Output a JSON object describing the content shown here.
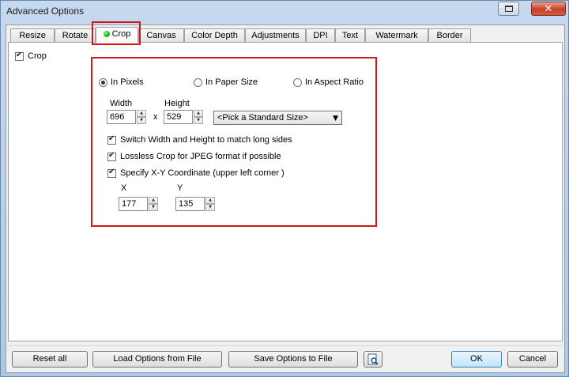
{
  "window": {
    "title": "Advanced Options"
  },
  "tabs": [
    "Resize",
    "Rotate",
    "Crop",
    "Canvas",
    "Color Depth",
    "Adjustments",
    "DPI",
    "Text",
    "Watermark",
    "Border"
  ],
  "active_tab": "Crop",
  "crop": {
    "enable_label": "Crop",
    "enable_checked": true,
    "mode_options": [
      "In Pixels",
      "In Paper Size",
      "In Aspect Ratio"
    ],
    "selected_mode": "In Pixels",
    "width_label": "Width",
    "height_label": "Height",
    "width_value": "696",
    "height_value": "529",
    "times_label": "x",
    "standard_size": "<Pick a Standard Size>",
    "options": [
      {
        "label": "Switch Width and Height to match long sides",
        "checked": true
      },
      {
        "label": "Lossless Crop for JPEG format if possible",
        "checked": true
      },
      {
        "label": "Specify X-Y Coordinate (upper left corner )",
        "checked": true
      }
    ],
    "x_label": "X",
    "y_label": "Y",
    "x_value": "177",
    "y_value": "135"
  },
  "buttons": {
    "reset_all": "Reset all",
    "load": "Load Options from File",
    "save": "Save Options to File",
    "ok": "OK",
    "cancel": "Cancel"
  },
  "colors": {
    "highlight": "#d01818",
    "active_dot": "#14a214"
  }
}
